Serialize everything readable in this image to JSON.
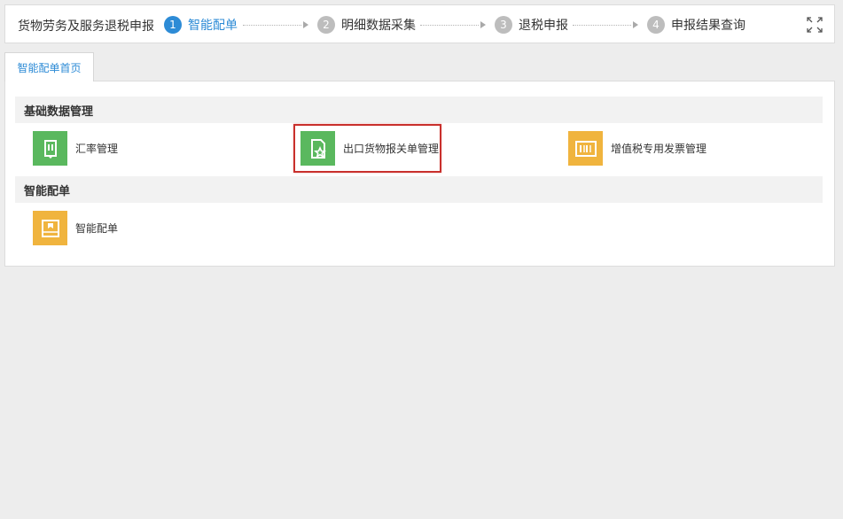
{
  "header": {
    "app_title": "货物劳务及服务退税申报",
    "steps": [
      {
        "number": "1",
        "label": "智能配单",
        "active": true
      },
      {
        "number": "2",
        "label": "明细数据采集",
        "active": false
      },
      {
        "number": "3",
        "label": "退税申报",
        "active": false
      },
      {
        "number": "4",
        "label": "申报结果查询",
        "active": false
      }
    ],
    "expand_icon": "fullscreen-expand-icon"
  },
  "tabs": [
    {
      "label": "智能配单首页",
      "active": true
    }
  ],
  "sections": [
    {
      "title": "基础数据管理",
      "items": [
        {
          "label": "汇率管理",
          "icon": "document-edit-icon",
          "color": "#5ab85e"
        },
        {
          "label": "出口货物报关单管理",
          "icon": "document-star-icon",
          "color": "#5ab85e",
          "highlighted": true
        },
        {
          "label": "增值税专用发票管理",
          "icon": "invoice-barcode-icon",
          "color": "#f0b43e"
        }
      ]
    },
    {
      "title": "智能配单",
      "items": [
        {
          "label": "智能配单",
          "icon": "chart-board-icon",
          "color": "#f0b43e"
        }
      ]
    }
  ],
  "colors": {
    "accent": "#2d8bd6",
    "inactive_step": "#bdbdbd",
    "green_tile": "#5ab85e",
    "orange_tile": "#f0b43e",
    "highlight_border": "#c9302c"
  }
}
